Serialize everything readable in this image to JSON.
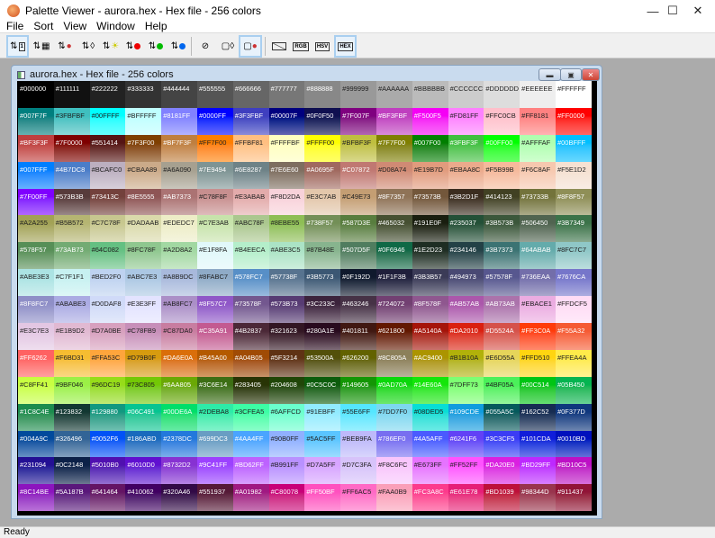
{
  "app": {
    "title": "Palette Viewer - aurora.hex - Hex file - 256 colors"
  },
  "menu": [
    "File",
    "Sort",
    "View",
    "Window",
    "Help"
  ],
  "toolbar": {
    "rgb_label": "RGB",
    "hsv_label": "HSV",
    "hex_label": "HEX",
    "sort_index_label": "1"
  },
  "child": {
    "title": "aurora.hex - Hex file - 256 colors"
  },
  "status": "Ready",
  "colors": [
    [
      "#000000",
      "#111111",
      "#222222",
      "#333333",
      "#444444",
      "#555555",
      "#666666",
      "#777777",
      "#888888",
      "#999999",
      "#AAAAAA",
      "#BBBBBB",
      "#CCCCCC",
      "#DDDDDD",
      "#EEEEEE",
      "#FFFFFF"
    ],
    [
      "#007F7F",
      "#3FBFBF",
      "#00FFFF",
      "#BFFFFF",
      "#8181FF",
      "#0000FF",
      "#3F3FBF",
      "#00007F",
      "#0F0F50",
      "#7F007F",
      "#BF3FBF",
      "#F500F5",
      "#FD81FF",
      "#FFC0CB",
      "#FF8181",
      "#FF0000"
    ],
    [
      "#BF3F3F",
      "#7F0000",
      "#551414",
      "#7F3F00",
      "#BF7F3F",
      "#FF7F00",
      "#FFBF81",
      "#FFFFBF",
      "#FFFF00",
      "#BFBF3F",
      "#7F7F00",
      "#007F00",
      "#3FBF3F",
      "#00FF00",
      "#AFFFAF",
      "#00BFFF"
    ],
    [
      "#007FFF",
      "#4B7DC8",
      "#BCAFC0",
      "#CBAA89",
      "#A6A090",
      "#7E9494",
      "#6E8287",
      "#7E6E60",
      "#A0695F",
      "#C07872",
      "#D08A74",
      "#E19B7D",
      "#EBAA8C",
      "#F5B99B",
      "#F6C8AF",
      "#F5E1D2"
    ],
    [
      "#7F00FF",
      "#573B3B",
      "#73413C",
      "#8E5555",
      "#AB7373",
      "#C78F8F",
      "#E3ABAB",
      "#F8D2DA",
      "#E3C7AB",
      "#C49E73",
      "#8F7357",
      "#73573B",
      "#3B2D1F",
      "#414123",
      "#73733B",
      "#8F8F57"
    ],
    [
      "#A2A255",
      "#B5B572",
      "#C7C78F",
      "#DADAAB",
      "#EDEDC7",
      "#C7E3AB",
      "#ABC78F",
      "#8EBE55",
      "#738F57",
      "#587D3E",
      "#465032",
      "#191E0F",
      "#235037",
      "#3B573B",
      "#506450",
      "#3B7349"
    ],
    [
      "#578F57",
      "#73AB73",
      "#64C082",
      "#8FC78F",
      "#A2D8A2",
      "#E1F8FA",
      "#B4EECA",
      "#ABE3C5",
      "#87B48E",
      "#507D5F",
      "#0F6946",
      "#1E2D23",
      "#234146",
      "#3B7373",
      "#64ABAB",
      "#8FC7C7"
    ],
    [
      "#ABE3E3",
      "#C7F1F1",
      "#BED2F0",
      "#ABC7E3",
      "#A8B9DC",
      "#8FABC7",
      "#578FC7",
      "#57738F",
      "#3B5773",
      "#0F192D",
      "#1F1F3B",
      "#3B3B57",
      "#494973",
      "#57578F",
      "#736EAA",
      "#7676CA"
    ],
    [
      "#8F8FC7",
      "#ABABE3",
      "#D0DAF8",
      "#E3E3FF",
      "#AB8FC7",
      "#8F57C7",
      "#73578F",
      "#573B73",
      "#3C233C",
      "#463246",
      "#724072",
      "#8F578F",
      "#AB57AB",
      "#AB73AB",
      "#EBACE1",
      "#FFDCF5"
    ],
    [
      "#E3C7E3",
      "#E1B9D2",
      "#D7A0BE",
      "#C78FB9",
      "#C87DA0",
      "#C35A91",
      "#4B2837",
      "#321623",
      "#280A1E",
      "#401811",
      "#621800",
      "#A5140A",
      "#DA2010",
      "#D5524A",
      "#FF3C0A",
      "#F55A32"
    ],
    [
      "#FF6262",
      "#F6BD31",
      "#FFA53C",
      "#D79B0F",
      "#DA6E0A",
      "#B45A00",
      "#A04B05",
      "#5F3214",
      "#53500A",
      "#626200",
      "#8C805A",
      "#AC9400",
      "#B1B10A",
      "#E6D55A",
      "#FFD510",
      "#FFEA4A"
    ],
    [
      "#C8FF41",
      "#9BF046",
      "#96DC19",
      "#73C805",
      "#6AA805",
      "#3C6E14",
      "#283405",
      "#204608",
      "#0C5C0C",
      "#149605",
      "#0AD70A",
      "#14E60A",
      "#7DFF73",
      "#4BF05A",
      "#00C514",
      "#05B450"
    ],
    [
      "#1C8C4E",
      "#123832",
      "#129880",
      "#06C491",
      "#00DE6A",
      "#2DEBA8",
      "#3CFEA5",
      "#6AFFCD",
      "#91EBFF",
      "#55E6FF",
      "#7DD7F0",
      "#08DED5",
      "#109CDE",
      "#055A5C",
      "#162C52",
      "#0F377D"
    ],
    [
      "#004A9C",
      "#326496",
      "#0052F6",
      "#186ABD",
      "#2378DC",
      "#699DC3",
      "#4AA4FF",
      "#90B0FF",
      "#5AC5FF",
      "#BEB9FA",
      "#786EF0",
      "#4A5AFF",
      "#6241F6",
      "#3C3CF5",
      "#101CDA",
      "#0010BD"
    ],
    [
      "#231094",
      "#0C2148",
      "#5010B0",
      "#6010D0",
      "#8732D2",
      "#9C41FF",
      "#BD62FF",
      "#B991FF",
      "#D7A5FF",
      "#D7C3FA",
      "#F8C6FC",
      "#E673FF",
      "#FF52FF",
      "#DA20E0",
      "#BD29FF",
      "#BD10C5"
    ],
    [
      "#8C14BE",
      "#5A187B",
      "#641464",
      "#410062",
      "#320A46",
      "#551937",
      "#A01982",
      "#C80078",
      "#FF50BF",
      "#FF6AC5",
      "#FAA0B9",
      "#FC3A8C",
      "#E61E78",
      "#BD1039",
      "#98344D",
      "#911437"
    ]
  ]
}
